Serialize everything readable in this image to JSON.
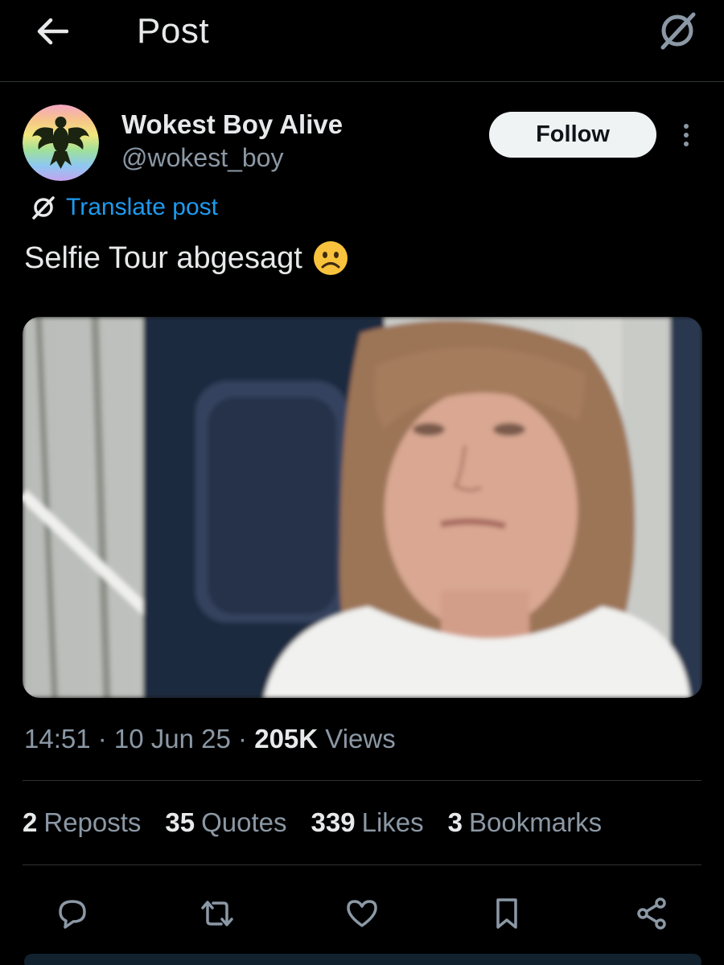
{
  "header": {
    "title": "Post"
  },
  "author": {
    "display_name": "Wokest Boy Alive",
    "handle": "@wokest_boy"
  },
  "follow_label": "Follow",
  "translate_label": "Translate post",
  "post": {
    "text": "Selfie Tour abgesagt",
    "emoji": "☹️"
  },
  "meta": {
    "time": "14:51",
    "date": "10 Jun 25",
    "views_count": "205K",
    "views_label": "Views"
  },
  "stats": [
    {
      "count": "2",
      "label": "Reposts"
    },
    {
      "count": "35",
      "label": "Quotes"
    },
    {
      "count": "339",
      "label": "Likes"
    },
    {
      "count": "3",
      "label": "Bookmarks"
    }
  ],
  "icons": {
    "back": "arrow-left-icon",
    "translate": "translate-icon",
    "more": "more-vertical-icon",
    "reply": "reply-icon",
    "repost": "repost-icon",
    "like": "heart-icon",
    "bookmark": "bookmark-icon",
    "share": "share-icon"
  },
  "colors": {
    "background": "#000000",
    "accent": "#1d9bf0",
    "muted": "#8b98a5",
    "text": "#e7e9ea"
  }
}
